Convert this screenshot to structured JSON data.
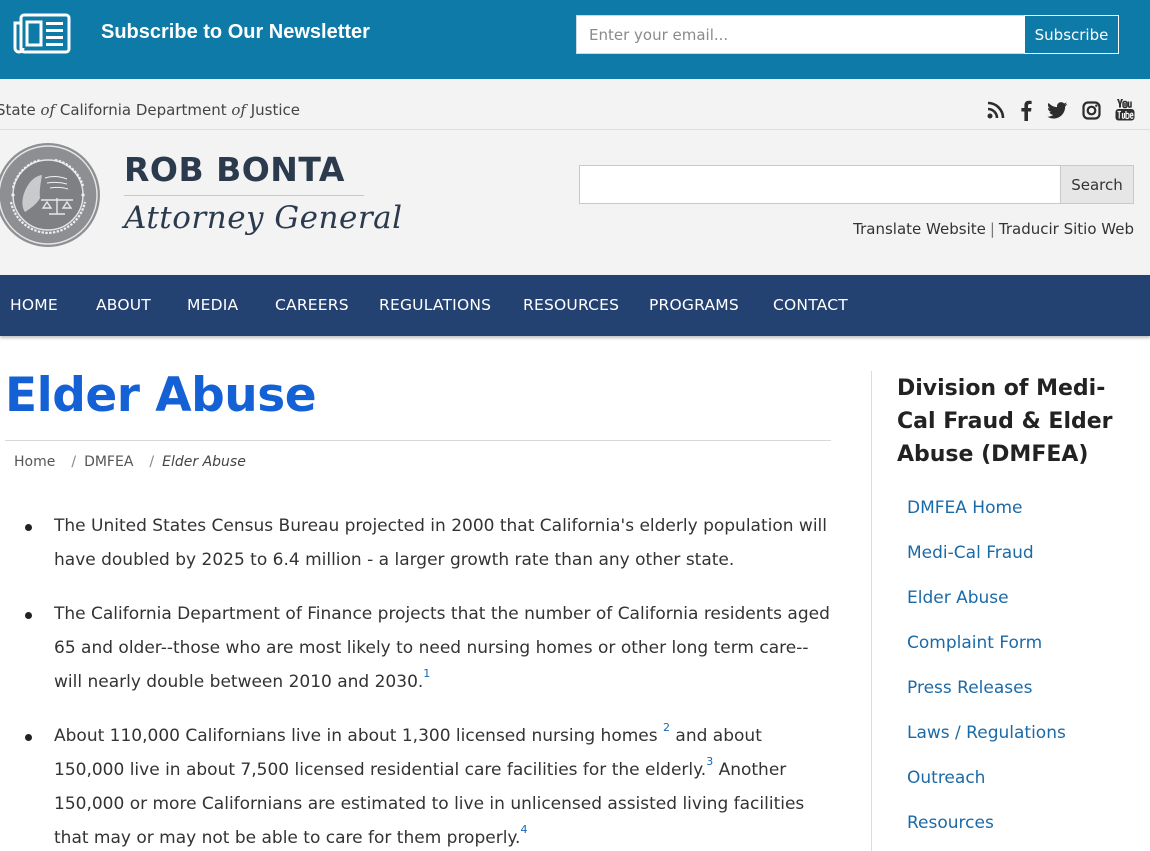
{
  "newsletter": {
    "title": "Subscribe to Our Newsletter",
    "email_placeholder": "Enter your email...",
    "subscribe_label": "Subscribe",
    "icon": "newspaper-icon"
  },
  "utility": {
    "state_prefix": "State ",
    "state_of_1": "of",
    "state_mid": " California Department ",
    "state_of_2": "of",
    "state_suffix": " Justice",
    "social_icons": [
      "rss-icon",
      "facebook-icon",
      "twitter-icon",
      "instagram-icon",
      "youtube-icon"
    ]
  },
  "header": {
    "seal_icon": "california-doj-seal",
    "name": "ROB BONTA",
    "title": "Attorney General",
    "search_placeholder": "",
    "search_label": "Search",
    "translate_label": "Translate Website",
    "translate_sep": "|",
    "traducir_label": "Traducir Sitio Web"
  },
  "nav": {
    "items": [
      "HOME",
      "ABOUT",
      "MEDIA",
      "CAREERS",
      "REGULATIONS",
      "RESOURCES",
      "PROGRAMS",
      "CONTACT"
    ]
  },
  "main": {
    "title": "Elder Abuse",
    "breadcrumb": {
      "home": "Home",
      "sep": "/",
      "section": "DMFEA",
      "current": "Elder Abuse"
    },
    "bullets": [
      {
        "text": "The United States Census Bureau projected in 2000 that California's elderly population will have doubled by 2025 to 6.4 million - a larger growth rate than any other state."
      },
      {
        "text": "The California Department of Finance projects that the number of California residents aged 65 and older--those who are most likely to need nursing homes or other long term care--will nearly double between 2010 and 2030.",
        "footnote": "1"
      },
      {
        "part1": "About 110,000 Californians live in about 1,300 licensed nursing homes ",
        "fn1": "2",
        "part2": " and about 150,000 live in about 7,500 licensed residential care facilities for the elderly.",
        "fn2": "3",
        "part3": " Another 150,000 or more Californians are estimated to live in unlicensed assisted living facilities that may or may not be able to care for them properly.",
        "fn3": "4"
      }
    ]
  },
  "sidebar": {
    "title": "Division of Medi-Cal Fraud & Elder Abuse (DMFEA)",
    "links": [
      "DMFEA Home",
      "Medi-Cal Fraud",
      "Elder Abuse",
      "Complaint Form",
      "Press Releases",
      "Laws / Regulations",
      "Outreach",
      "Resources"
    ]
  },
  "colors": {
    "newsletter_bg": "#0d7aa8",
    "nav_bg": "#234272",
    "title_blue": "#1361d4",
    "link_blue": "#1b6aa8",
    "header_bg": "#f3f3f3"
  }
}
